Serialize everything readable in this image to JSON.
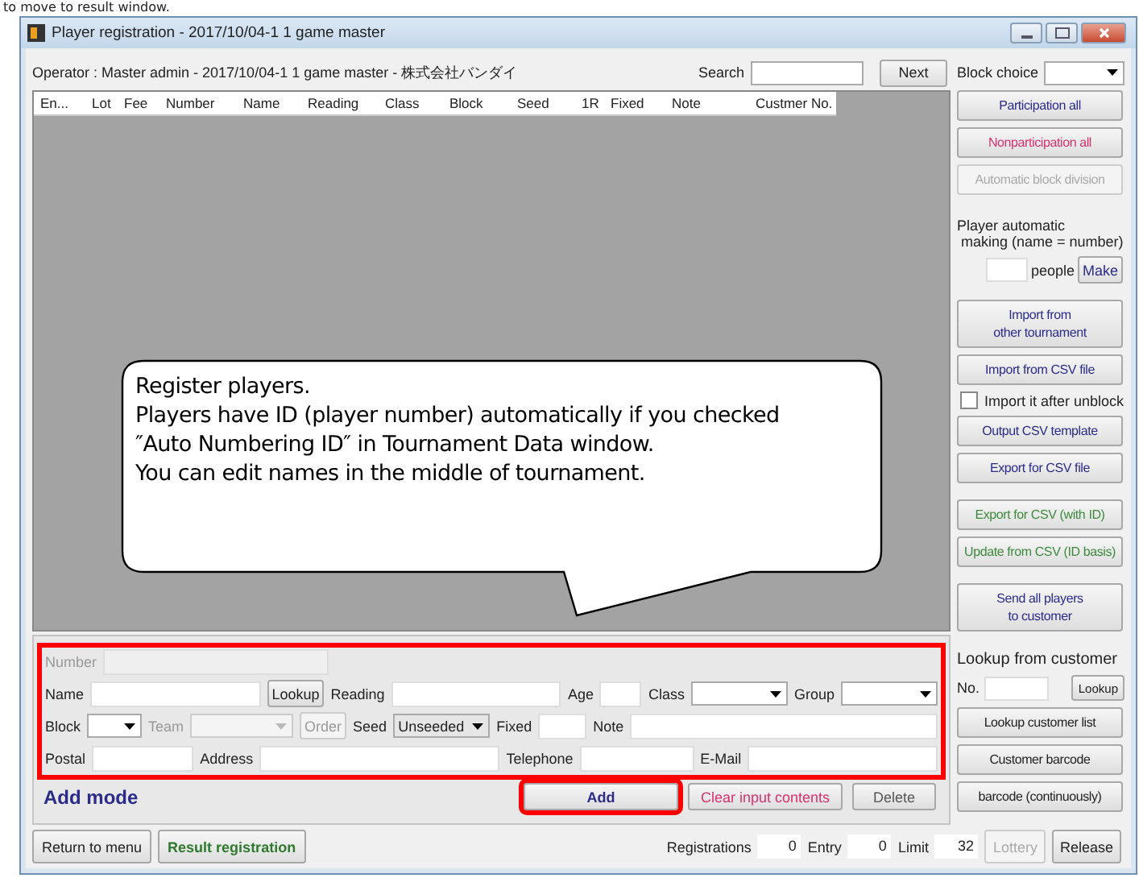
{
  "caption": "to move to result window.",
  "window": {
    "title": "Player registration - 2017/10/04-1 1 game master"
  },
  "operator": "Operator : Master admin - 2017/10/04-1 1 game master - 株式会社バンダイ",
  "search": {
    "label": "Search",
    "button": "Next"
  },
  "block_choice": {
    "label": "Block choice"
  },
  "table": {
    "columns": [
      "En...",
      "Lot",
      "Fee",
      "Number",
      "Name",
      "Reading",
      "Class",
      "Block",
      "Seed",
      "1R",
      "Fixed",
      "Note",
      "Custmer No."
    ]
  },
  "callout": {
    "lines": [
      "Register players.",
      "Players have ID (player number) automatically if you checked",
      "″Auto Numbering ID″ in Tournament Data window.",
      "You can edit names in the middle of tournament."
    ]
  },
  "sidebar": {
    "groups": [
      [
        {
          "kind": "button",
          "label": "Participation all",
          "color": "#2b2b8c",
          "disabled": false
        },
        {
          "kind": "button",
          "label": "Nonparticipation all",
          "color": "#d8316e",
          "disabled": false
        },
        {
          "kind": "button",
          "label": "Automatic block division",
          "color": "#aaaaaa",
          "disabled": true
        }
      ],
      [
        {
          "kind": "automake",
          "label": "Player automatic\n making (name = number)",
          "unit": "people",
          "button": "Make"
        }
      ],
      [
        {
          "kind": "button",
          "label": "Import from\nother tournament",
          "color": "#2b2b8c",
          "disabled": false
        },
        {
          "kind": "button",
          "label": "Import from CSV file",
          "color": "#2b2b8c",
          "disabled": false
        },
        {
          "kind": "checkbox",
          "label": "Import it after unblock",
          "checked": false
        },
        {
          "kind": "button",
          "label": "Output CSV template",
          "color": "#2b2b8c",
          "disabled": false
        },
        {
          "kind": "button",
          "label": "Export for CSV file",
          "color": "#2b2b8c",
          "disabled": false
        }
      ],
      [
        {
          "kind": "button",
          "label": "Export for CSV (with ID)",
          "color": "#3c8a3c",
          "disabled": false
        },
        {
          "kind": "button",
          "label": "Update from CSV (ID basis)",
          "color": "#3c8a3c",
          "disabled": false
        }
      ],
      [
        {
          "kind": "button",
          "label": "Send all players\nto customer",
          "color": "#2b2b8c",
          "disabled": false
        }
      ]
    ]
  },
  "form": {
    "highlighted": true,
    "rows": [
      [
        {
          "kind": "input",
          "label": "Number",
          "disabled": true
        }
      ],
      [
        {
          "kind": "input",
          "label": "Name",
          "disabled": false
        },
        {
          "kind": "button",
          "label": "Lookup",
          "disabled": false
        },
        {
          "kind": "input",
          "label": "Reading",
          "disabled": false
        },
        {
          "kind": "input",
          "label": "Age",
          "disabled": false
        },
        {
          "kind": "select",
          "label": "Class",
          "disabled": false
        },
        {
          "kind": "select",
          "label": "Group",
          "disabled": false
        }
      ],
      [
        {
          "kind": "select",
          "label": "Block",
          "disabled": false
        },
        {
          "kind": "select",
          "label": "Team",
          "disabled": true
        },
        {
          "kind": "button",
          "label": "Order",
          "disabled": true
        },
        {
          "kind": "select",
          "label": "Seed",
          "value": "Unseeded",
          "disabled": false
        },
        {
          "kind": "input",
          "label": "Fixed",
          "disabled": false
        },
        {
          "kind": "input",
          "label": "Note",
          "disabled": false
        }
      ],
      [
        {
          "kind": "input",
          "label": "Postal",
          "disabled": false
        },
        {
          "kind": "input",
          "label": "Address",
          "disabled": false
        },
        {
          "kind": "input",
          "label": "Telephone",
          "disabled": false
        },
        {
          "kind": "input",
          "label": "E-Mail",
          "disabled": false
        }
      ]
    ]
  },
  "mode": "Add mode",
  "actions": [
    {
      "label": "Add",
      "color": "#2b2b8c",
      "disabled": false,
      "highlighted": true
    },
    {
      "label": "Clear input contents",
      "color": "#d8316e",
      "disabled": false,
      "highlighted": false
    },
    {
      "label": "Delete",
      "color": "#555555",
      "disabled": false,
      "highlighted": false
    }
  ],
  "customer": {
    "title": "Lookup from customer",
    "no_label": "No.",
    "lookup": "Lookup",
    "buttons": [
      "Lookup customer list",
      "Customer barcode",
      "barcode (continuously)"
    ]
  },
  "footer": {
    "buttons": [
      {
        "label": "Return to menu",
        "color": "#222222"
      },
      {
        "label": "Result registration",
        "color": "#2f7a2f"
      }
    ],
    "counters": [
      {
        "label": "Registrations",
        "value": "0"
      },
      {
        "label": "Entry",
        "value": "0"
      },
      {
        "label": "Limit",
        "value": "32"
      }
    ],
    "lottery": {
      "label": "Lottery",
      "disabled": true
    },
    "release": "Release"
  }
}
